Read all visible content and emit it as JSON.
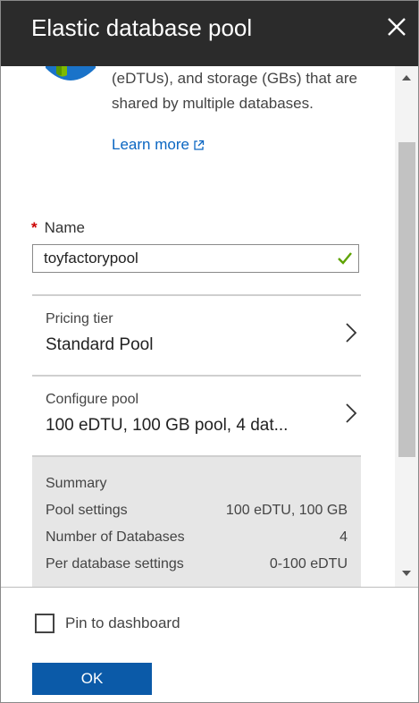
{
  "header": {
    "title": "Elastic database pool",
    "close_icon": "close-icon"
  },
  "intro": {
    "description": "(eDTUs), and storage (GBs) that are shared by multiple databases.",
    "learn_more": "Learn more"
  },
  "name_field": {
    "required_marker": "*",
    "label": "Name",
    "value": "toyfactorypool"
  },
  "pricing_tier": {
    "label": "Pricing tier",
    "value": "Standard Pool"
  },
  "configure_pool": {
    "label": "Configure pool",
    "value": "100 eDTU, 100 GB pool, 4 dat..."
  },
  "summary": {
    "title": "Summary",
    "rows": [
      {
        "label": "Pool settings",
        "value": "100 eDTU, 100 GB"
      },
      {
        "label": "Number of Databases",
        "value": "4"
      },
      {
        "label": "Per database settings",
        "value": "0-100 eDTU"
      }
    ]
  },
  "footer": {
    "pin_label": "Pin to dashboard",
    "ok_label": "OK"
  },
  "colors": {
    "header_bg": "#2b2b2b",
    "link": "#0a66c2",
    "ok_button": "#0b5aa8",
    "check": "#5ea300",
    "required": "#cc0000"
  }
}
